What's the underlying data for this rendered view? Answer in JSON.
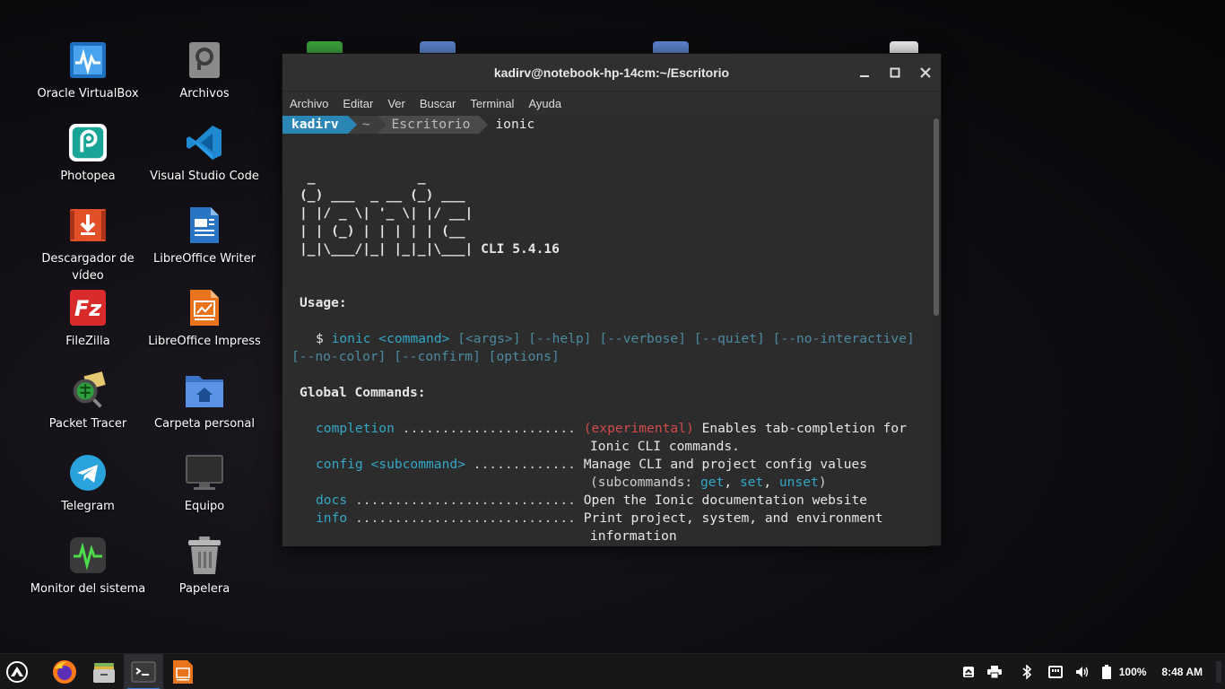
{
  "desktop": {
    "icons": [
      {
        "label": "Oracle VirtualBox",
        "icon": "virtualbox-icon"
      },
      {
        "label": "Archivos",
        "icon": "files-icon"
      },
      {
        "label": "Photopea",
        "icon": "photopea-icon"
      },
      {
        "label": "Visual Studio Code",
        "icon": "vscode-icon"
      },
      {
        "label": "Descargador de vídeo",
        "icon": "video-downloader-icon"
      },
      {
        "label": "LibreOffice Writer",
        "icon": "writer-icon"
      },
      {
        "label": "FileZilla",
        "icon": "filezilla-icon"
      },
      {
        "label": "LibreOffice Impress",
        "icon": "impress-icon"
      },
      {
        "label": "Packet Tracer",
        "icon": "packet-tracer-icon"
      },
      {
        "label": "Carpeta personal",
        "icon": "home-folder-icon"
      },
      {
        "label": "Telegram",
        "icon": "telegram-icon"
      },
      {
        "label": "Equipo",
        "icon": "computer-icon"
      },
      {
        "label": "Monitor del sistema",
        "icon": "system-monitor-icon"
      },
      {
        "label": "Papelera",
        "icon": "trash-icon"
      }
    ]
  },
  "window": {
    "title": "kadirv@notebook-hp-14cm:~/Escritorio",
    "menu": [
      "Archivo",
      "Editar",
      "Ver",
      "Buscar",
      "Terminal",
      "Ayuda"
    ]
  },
  "terminal": {
    "prompt_user": "kadirv",
    "prompt_home": "~",
    "prompt_dir": "Escritorio",
    "command": "ionic",
    "ascii": [
      " _             _",
      "(_) ___  _ __ (_) ___",
      "| |/ _ \\| '_ \\| |/ __|",
      "| | (_) | | | | | (__",
      "|_|\\___/|_| |_|_|\\___|"
    ],
    "cli_version": "CLI 5.4.16",
    "usage_heading": "Usage:",
    "usage_dollar": "$",
    "usage_cmd": "ionic <command>",
    "usage_opts1": "[<args>] [--help] [--verbose] [--quiet] [--no-interactive]",
    "usage_opts2": "[--no-color] [--confirm] [options]",
    "global_heading": "Global Commands:",
    "commands": [
      {
        "name": "completion",
        "dots": " ......................",
        "tag": "(experimental)",
        "desc": " Enables tab-completion for",
        "desc2": "Ionic CLI commands."
      },
      {
        "name": "config <subcommand>",
        "dots": " .............",
        "desc": "Manage CLI and project config values",
        "sub_pre": "(subcommands: ",
        "sub": [
          "get",
          "set",
          "unset"
        ],
        "sub_post": ")"
      },
      {
        "name": "docs",
        "dots": " ............................",
        "desc": "Open the Ionic documentation website"
      },
      {
        "name": "info",
        "dots": " ............................",
        "desc": "Print project, system, and environment",
        "desc2": "information"
      }
    ]
  },
  "taskbar": {
    "apps": [
      "firefox-icon",
      "file-manager-icon",
      "terminal-icon",
      "impress-icon"
    ],
    "battery": "100%",
    "clock": "8:48 AM"
  },
  "colors": {
    "accent": "#3a7bd5",
    "prompt_user_bg": "#2a86b5",
    "cyan": "#34a6c7",
    "red": "#d24a4a"
  }
}
